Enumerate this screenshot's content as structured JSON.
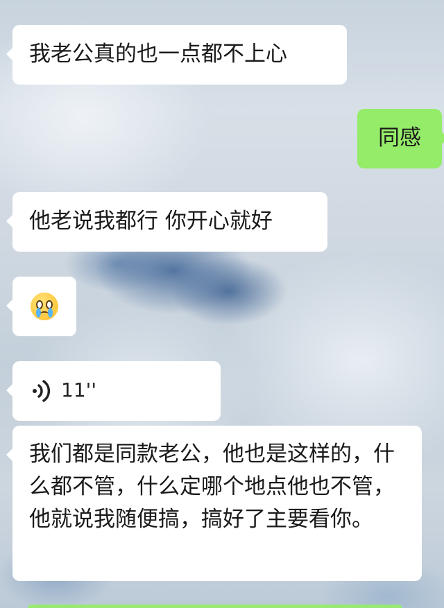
{
  "messages": [
    {
      "side": "left",
      "type": "text",
      "text": "我老公真的也一点都不上心"
    },
    {
      "side": "right",
      "type": "text",
      "text": "同感"
    },
    {
      "side": "left",
      "type": "text",
      "text": "他老说我都行 你开心就好"
    },
    {
      "side": "left",
      "type": "emoji",
      "icon": "crying-face-emoji"
    },
    {
      "side": "left",
      "type": "voice",
      "duration": "11''"
    },
    {
      "side": "left",
      "type": "text",
      "text": "我们都是同款老公，他也是这样的，什么都不管，什么定哪个地点他也不管，他就说我随便搞，搞好了主要看你。"
    }
  ],
  "colors": {
    "incoming_bubble": "#ffffff",
    "outgoing_bubble": "#95ec69",
    "text": "#1a1a1a"
  }
}
